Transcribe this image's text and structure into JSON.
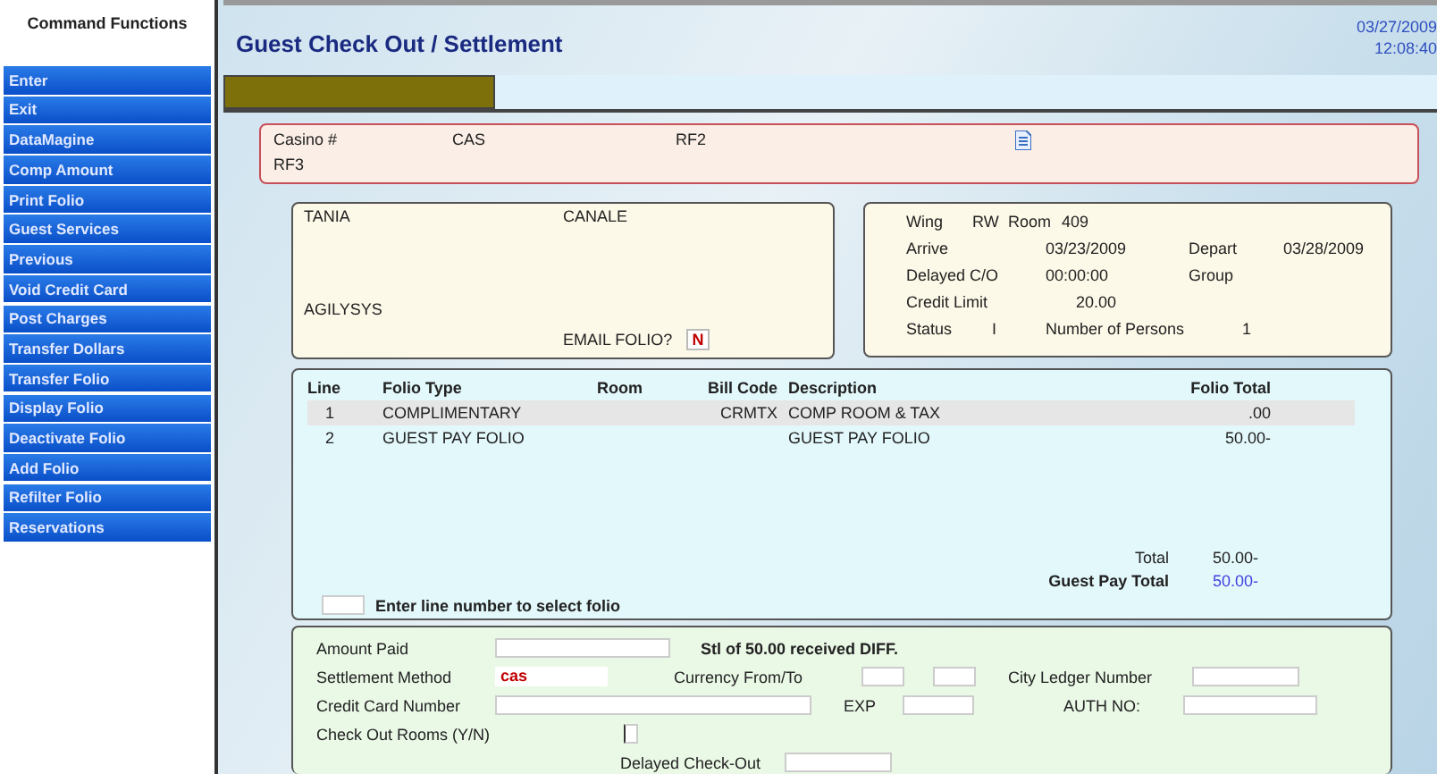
{
  "sidebar": {
    "title": "Command Functions",
    "items": [
      {
        "label": "Enter"
      },
      {
        "label": "Exit"
      },
      {
        "label": "DataMagine"
      },
      {
        "label": "Comp Amount"
      },
      {
        "label": "Print Folio"
      },
      {
        "label": "Guest Services"
      },
      {
        "label": "Previous"
      },
      {
        "label": "Void Credit Card"
      },
      {
        "label": "Post Charges"
      },
      {
        "label": "Transfer Dollars"
      },
      {
        "label": "Transfer Folio"
      },
      {
        "label": "Display Folio"
      },
      {
        "label": "Deactivate Folio"
      },
      {
        "label": "Add Folio"
      },
      {
        "label": "Refilter Folio"
      },
      {
        "label": "Reservations"
      }
    ]
  },
  "header": {
    "title": "Guest Check Out / Settlement",
    "date": "03/27/2009",
    "time": "12:08:40"
  },
  "casino": {
    "label": "Casino #",
    "value": "CAS",
    "field_2": "RF2",
    "field_3": "RF3"
  },
  "guest": {
    "first_name": "TANIA",
    "last_name": "CANALE",
    "company": "AGILYSYS",
    "email_label": "EMAIL FOLIO?",
    "email_value": "N"
  },
  "stay": {
    "wing": {
      "label": "Wing",
      "value": "RW"
    },
    "room": {
      "label": "Room",
      "value": "409"
    },
    "arrive": {
      "label": "Arrive",
      "value": "03/23/2009"
    },
    "depart": {
      "label": "Depart",
      "value": "03/28/2009"
    },
    "delayed": {
      "label": "Delayed C/O",
      "value": "00:00:00"
    },
    "group": {
      "label": "Group"
    },
    "credit_limit": {
      "label": "Credit Limit",
      "value": "20.00"
    },
    "status": {
      "label": "Status",
      "value": "I"
    },
    "persons": {
      "label": "Number of Persons",
      "value": "1"
    }
  },
  "folios": {
    "columns": [
      "Line",
      "Folio Type",
      "Room",
      "Bill Code",
      "Description",
      "Folio Total"
    ],
    "rows": [
      {
        "cells": [
          "1",
          "COMPLIMENTARY",
          "",
          "CRMTX",
          "COMP ROOM & TAX",
          ".00"
        ],
        "selected": true
      },
      {
        "cells": [
          "2",
          "GUEST PAY FOLIO",
          "",
          "",
          "GUEST PAY FOLIO",
          "50.00-"
        ],
        "selected": false
      }
    ],
    "total_label": "Total",
    "total": "50.00-",
    "guest_pay_label": "Guest Pay Total",
    "guest_pay_total": "50.00-",
    "select_hint": "Enter line number to select folio"
  },
  "settlement": {
    "amount_paid": "Amount Paid",
    "message": "Stl of 50.00 received DIFF.",
    "method_label": "Settlement Method",
    "method_value": "cas",
    "currency_label": "Currency From/To",
    "city_ledger_label": "City Ledger Number",
    "card_label": "Credit Card Number",
    "exp_label": "EXP",
    "auth_label": "AUTH NO:",
    "checkout_label": "Check Out Rooms (Y/N)",
    "delayed_label": "Delayed Check-Out"
  }
}
